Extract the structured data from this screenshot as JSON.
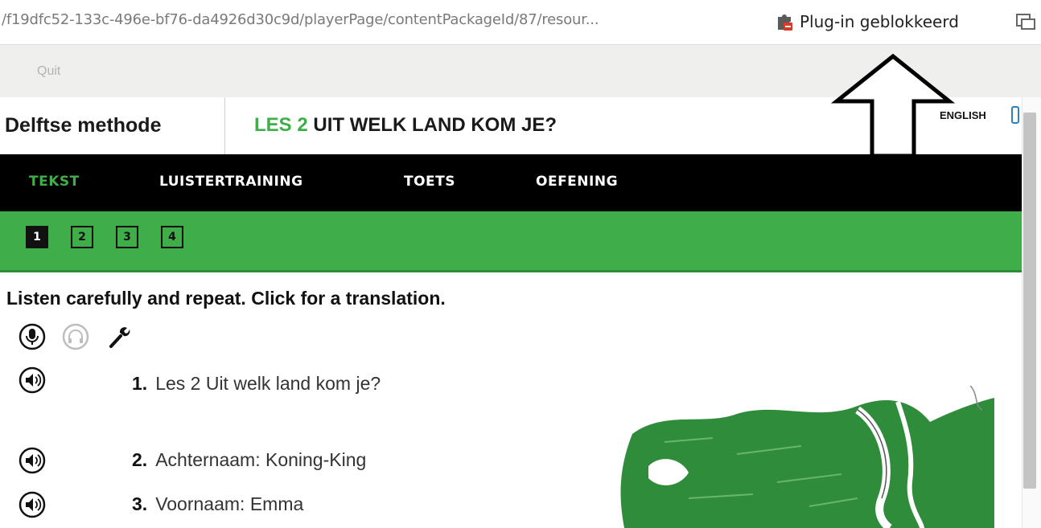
{
  "browser": {
    "url": "/f19dfc52-133c-496e-bf76-da4926d30c9d/playerPage/contentPackageId/87/resour...",
    "plugin_notice": "Plug-in geblokkeerd"
  },
  "toolbar": {
    "quit_label": "Quit"
  },
  "header": {
    "brand": "Delftse methode",
    "lesson_number": "LES 2",
    "lesson_title": "UIT WELK LAND KOM JE?",
    "language_label": "ENGLISH"
  },
  "nav": {
    "tabs": [
      {
        "label": "TEKST",
        "active": true
      },
      {
        "label": "LUISTERTRAINING",
        "active": false
      },
      {
        "label": "TOETS",
        "active": false
      },
      {
        "label": "OEFENING",
        "active": false
      }
    ]
  },
  "steps": [
    "1",
    "2",
    "3",
    "4"
  ],
  "active_step": "1",
  "content": {
    "instruction": "Listen carefully and repeat. Click for a translation.",
    "tools": [
      "microphone-icon",
      "headphones-icon",
      "wrench-icon"
    ],
    "items": [
      {
        "number": "1.",
        "text": "Les 2 Uit welk land kom je?"
      },
      {
        "number": "2.",
        "text": "Achternaam: Koning-King"
      },
      {
        "number": "3.",
        "text": "Voornaam: Emma"
      }
    ]
  },
  "colors": {
    "accent_green": "#3fae49",
    "nav_bg": "#000000",
    "link_blue": "#2b82c4"
  }
}
